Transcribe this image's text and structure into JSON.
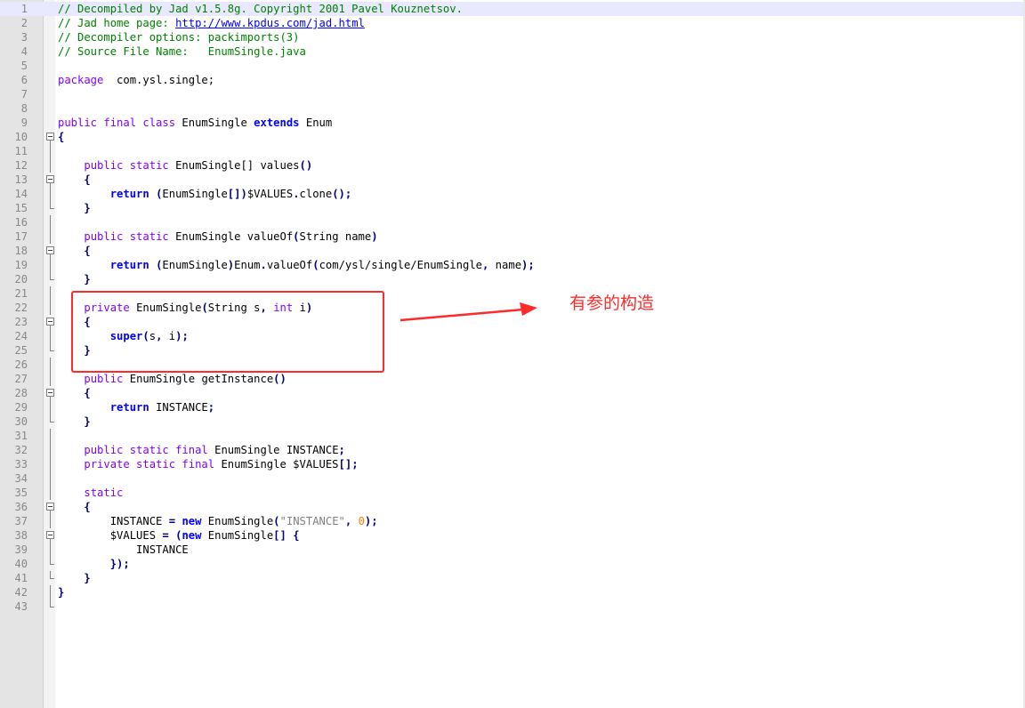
{
  "editor": {
    "lines": [
      {
        "n": "1",
        "current": true,
        "fold": "",
        "tokens": [
          [
            "cm",
            "// Decompiled by Jad v1.5.8g. Copyright 2001 Pavel Kouznetsov."
          ]
        ]
      },
      {
        "n": "2",
        "fold": "",
        "tokens": [
          [
            "cm",
            "// Jad home page: "
          ],
          [
            "url",
            "http://www.kpdus.com/jad.html"
          ]
        ]
      },
      {
        "n": "3",
        "fold": "",
        "tokens": [
          [
            "cm",
            "// Decompiler options: packimports(3)"
          ]
        ]
      },
      {
        "n": "4",
        "fold": "",
        "tokens": [
          [
            "cm",
            "// Source File Name:   EnumSingle.java"
          ]
        ]
      },
      {
        "n": "5",
        "fold": "",
        "tokens": []
      },
      {
        "n": "6",
        "fold": "",
        "tokens": [
          [
            "kw",
            "package"
          ],
          [
            "",
            "  com.ysl.single;"
          ]
        ]
      },
      {
        "n": "7",
        "fold": "",
        "tokens": []
      },
      {
        "n": "8",
        "fold": "",
        "tokens": []
      },
      {
        "n": "9",
        "fold": "",
        "tokens": [
          [
            "kw",
            "public final class"
          ],
          [
            "",
            " EnumSingle "
          ],
          [
            "kb",
            "extends"
          ],
          [
            "",
            " Enum"
          ]
        ]
      },
      {
        "n": "10",
        "fold": "box",
        "tokens": [
          [
            "op",
            "{"
          ]
        ]
      },
      {
        "n": "11",
        "fold": "line",
        "tokens": []
      },
      {
        "n": "12",
        "fold": "line",
        "tokens": [
          [
            "",
            "    "
          ],
          [
            "kw",
            "public static"
          ],
          [
            "",
            " EnumSingle[] values"
          ],
          [
            "op",
            "()"
          ]
        ]
      },
      {
        "n": "13",
        "fold": "box",
        "tokens": [
          [
            "",
            "    "
          ],
          [
            "op",
            "{"
          ]
        ]
      },
      {
        "n": "14",
        "fold": "line",
        "tokens": [
          [
            "",
            "        "
          ],
          [
            "kb",
            "return"
          ],
          [
            "",
            " "
          ],
          [
            "op",
            "("
          ],
          [
            "",
            "EnumSingle"
          ],
          [
            "op",
            "[])"
          ],
          [
            "",
            "$VALUES"
          ],
          [
            "op",
            "."
          ],
          [
            "",
            "clone"
          ],
          [
            "op",
            "();"
          ]
        ]
      },
      {
        "n": "15",
        "fold": "end",
        "tokens": [
          [
            "",
            "    "
          ],
          [
            "op",
            "}"
          ]
        ]
      },
      {
        "n": "16",
        "fold": "line",
        "tokens": []
      },
      {
        "n": "17",
        "fold": "line",
        "tokens": [
          [
            "",
            "    "
          ],
          [
            "kw",
            "public static"
          ],
          [
            "",
            " EnumSingle valueOf"
          ],
          [
            "op",
            "("
          ],
          [
            "",
            "String name"
          ],
          [
            "op",
            ")"
          ]
        ]
      },
      {
        "n": "18",
        "fold": "box",
        "tokens": [
          [
            "",
            "    "
          ],
          [
            "op",
            "{"
          ]
        ]
      },
      {
        "n": "19",
        "fold": "line",
        "tokens": [
          [
            "",
            "        "
          ],
          [
            "kb",
            "return"
          ],
          [
            "",
            " "
          ],
          [
            "op",
            "("
          ],
          [
            "",
            "EnumSingle"
          ],
          [
            "op",
            ")"
          ],
          [
            "",
            "Enum"
          ],
          [
            "op",
            "."
          ],
          [
            "",
            "valueOf"
          ],
          [
            "op",
            "("
          ],
          [
            "",
            "com/ysl/single/EnumSingle"
          ],
          [
            "op",
            ","
          ],
          [
            "",
            " name"
          ],
          [
            "op",
            ");"
          ]
        ]
      },
      {
        "n": "20",
        "fold": "end",
        "tokens": [
          [
            "",
            "    "
          ],
          [
            "op",
            "}"
          ]
        ]
      },
      {
        "n": "21",
        "fold": "line",
        "tokens": []
      },
      {
        "n": "22",
        "fold": "line",
        "tokens": [
          [
            "",
            "    "
          ],
          [
            "kw",
            "private"
          ],
          [
            "",
            " EnumSingle"
          ],
          [
            "op",
            "("
          ],
          [
            "",
            "String s"
          ],
          [
            "op",
            ","
          ],
          [
            "",
            " "
          ],
          [
            "kw",
            "int"
          ],
          [
            "",
            " i"
          ],
          [
            "op",
            ")"
          ]
        ]
      },
      {
        "n": "23",
        "fold": "box",
        "tokens": [
          [
            "",
            "    "
          ],
          [
            "op",
            "{"
          ]
        ]
      },
      {
        "n": "24",
        "fold": "line",
        "tokens": [
          [
            "",
            "        "
          ],
          [
            "kb",
            "super"
          ],
          [
            "op",
            "("
          ],
          [
            "",
            "s"
          ],
          [
            "op",
            ","
          ],
          [
            "",
            " i"
          ],
          [
            "op",
            ");"
          ]
        ]
      },
      {
        "n": "25",
        "fold": "end",
        "tokens": [
          [
            "",
            "    "
          ],
          [
            "op",
            "}"
          ]
        ]
      },
      {
        "n": "26",
        "fold": "line",
        "tokens": []
      },
      {
        "n": "27",
        "fold": "line",
        "tokens": [
          [
            "",
            "    "
          ],
          [
            "kw",
            "public"
          ],
          [
            "",
            " EnumSingle getInstance"
          ],
          [
            "op",
            "()"
          ]
        ]
      },
      {
        "n": "28",
        "fold": "box",
        "tokens": [
          [
            "",
            "    "
          ],
          [
            "op",
            "{"
          ]
        ]
      },
      {
        "n": "29",
        "fold": "line",
        "tokens": [
          [
            "",
            "        "
          ],
          [
            "kb",
            "return"
          ],
          [
            "",
            " INSTANCE"
          ],
          [
            "op",
            ";"
          ]
        ]
      },
      {
        "n": "30",
        "fold": "end",
        "tokens": [
          [
            "",
            "    "
          ],
          [
            "op",
            "}"
          ]
        ]
      },
      {
        "n": "31",
        "fold": "line",
        "tokens": []
      },
      {
        "n": "32",
        "fold": "line",
        "tokens": [
          [
            "",
            "    "
          ],
          [
            "kw",
            "public static final"
          ],
          [
            "",
            " EnumSingle INSTANCE"
          ],
          [
            "op",
            ";"
          ]
        ]
      },
      {
        "n": "33",
        "fold": "line",
        "tokens": [
          [
            "",
            "    "
          ],
          [
            "kw",
            "private static final"
          ],
          [
            "",
            " EnumSingle $VALUES"
          ],
          [
            "op",
            "[];"
          ]
        ]
      },
      {
        "n": "34",
        "fold": "line",
        "tokens": []
      },
      {
        "n": "35",
        "fold": "line",
        "tokens": [
          [
            "",
            "    "
          ],
          [
            "kw",
            "static"
          ]
        ]
      },
      {
        "n": "36",
        "fold": "box",
        "tokens": [
          [
            "",
            "    "
          ],
          [
            "op",
            "{"
          ]
        ]
      },
      {
        "n": "37",
        "fold": "line",
        "tokens": [
          [
            "",
            "        INSTANCE "
          ],
          [
            "op",
            "="
          ],
          [
            "",
            " "
          ],
          [
            "kb",
            "new"
          ],
          [
            "",
            " EnumSingle"
          ],
          [
            "op",
            "("
          ],
          [
            "st",
            "\"INSTANCE\""
          ],
          [
            "op",
            ","
          ],
          [
            "",
            " "
          ],
          [
            "nm",
            "0"
          ],
          [
            "op",
            ");"
          ]
        ]
      },
      {
        "n": "38",
        "fold": "box",
        "tokens": [
          [
            "",
            "        $VALUES "
          ],
          [
            "op",
            "="
          ],
          [
            "",
            " "
          ],
          [
            "op",
            "("
          ],
          [
            "kb",
            "new"
          ],
          [
            "",
            " EnumSingle"
          ],
          [
            "op",
            "[]"
          ],
          [
            "",
            " "
          ],
          [
            "op",
            "{"
          ]
        ]
      },
      {
        "n": "39",
        "fold": "line",
        "tokens": [
          [
            "",
            "            INSTANCE"
          ]
        ]
      },
      {
        "n": "40",
        "fold": "end",
        "tokens": [
          [
            "",
            "        "
          ],
          [
            "op",
            "});"
          ]
        ]
      },
      {
        "n": "41",
        "fold": "end",
        "tokens": [
          [
            "",
            "    "
          ],
          [
            "op",
            "}"
          ]
        ]
      },
      {
        "n": "42",
        "fold": "line",
        "tokens": [
          [
            "op",
            "}"
          ]
        ]
      },
      {
        "n": "43",
        "fold": "end",
        "tokens": []
      }
    ]
  },
  "annotation": {
    "text": "有参的构造",
    "color": "#ff2a2a"
  },
  "colors": {
    "comment": "#008000",
    "keyword": "#8000ff",
    "keyword_bold": "#0000ff",
    "operator": "#000080",
    "string": "#808080",
    "number": "#ff8000",
    "gutter": "#e4e4e4",
    "current_line": "#e8e8ff"
  }
}
